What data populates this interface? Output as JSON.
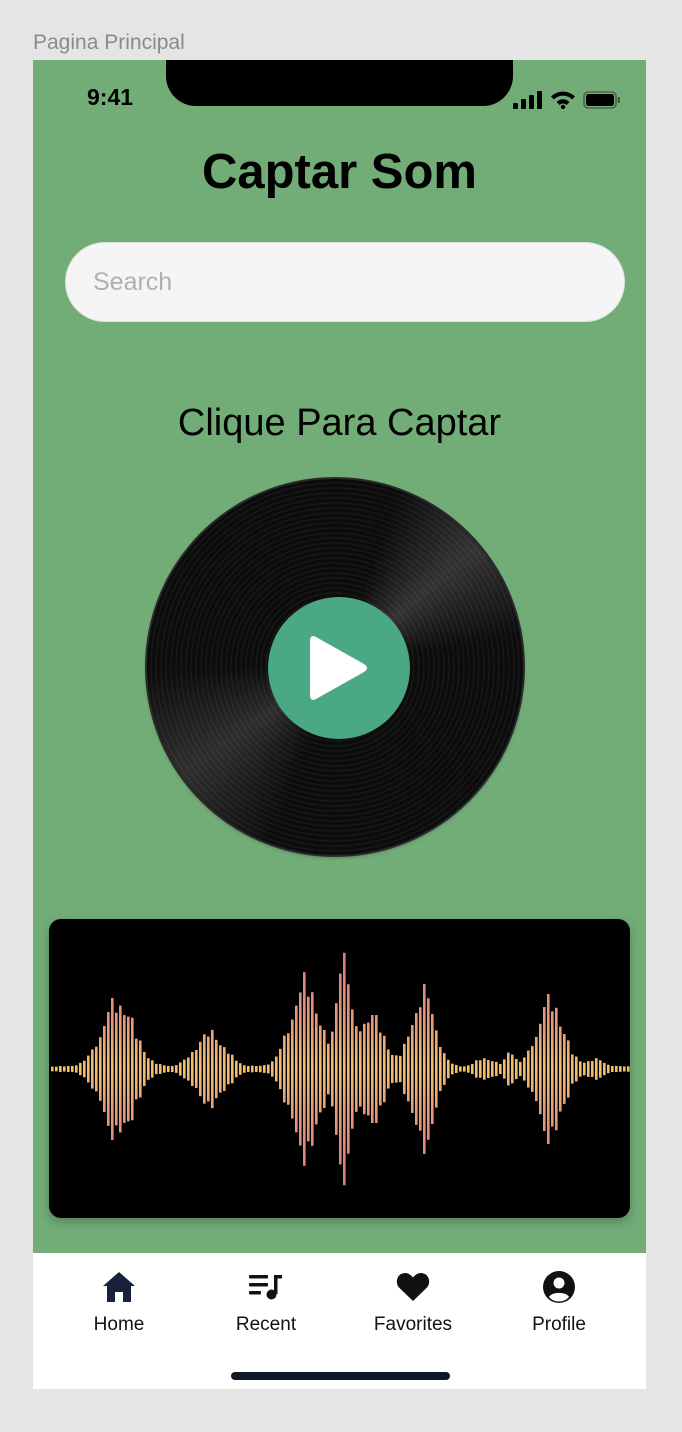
{
  "frame_label": "Pagina Principal",
  "status_bar": {
    "time": "9:41",
    "icons": [
      "signal-icon",
      "wifi-icon",
      "battery-icon"
    ]
  },
  "header": {
    "title": "Captar Som"
  },
  "search": {
    "placeholder": "Search",
    "value": ""
  },
  "capture": {
    "prompt": "Clique Para Captar",
    "record_icon": "vinyl-record-icon",
    "play_icon": "play-icon"
  },
  "waveform": {
    "icon": "sound-waveform-image"
  },
  "bottom_nav": {
    "items": [
      {
        "label": "Home",
        "icon": "home-icon"
      },
      {
        "label": "Recent",
        "icon": "playlist-icon"
      },
      {
        "label": "Favorites",
        "icon": "heart-icon"
      },
      {
        "label": "Profile",
        "icon": "account-circle-icon"
      }
    ]
  },
  "colors": {
    "background": "#72ad78",
    "play_button": "#4aa982",
    "nav_background": "#ffffff",
    "waveform_gradient": [
      "#f2c06e",
      "#d86a86"
    ]
  }
}
